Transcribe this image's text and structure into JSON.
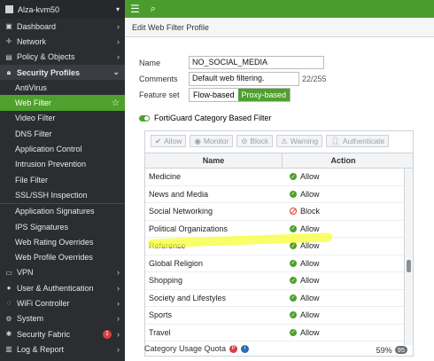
{
  "sidebar": {
    "device": "Alza-kvm50",
    "items": [
      {
        "label": "Dashboard",
        "icon": "dashboard-icon"
      },
      {
        "label": "Network",
        "icon": "network-icon"
      },
      {
        "label": "Policy & Objects",
        "icon": "policy-icon"
      },
      {
        "label": "Security Profiles",
        "icon": "lock-icon"
      }
    ],
    "sub": [
      "AntiVirus",
      "Web Filter",
      "Video Filter",
      "DNS Filter",
      "Application Control",
      "Intrusion Prevention",
      "File Filter",
      "SSL/SSH Inspection"
    ],
    "sub2": [
      "Application Signatures",
      "IPS Signatures",
      "Web Rating Overrides",
      "Web Profile Overrides"
    ],
    "items2": [
      {
        "label": "VPN",
        "icon": "vpn-icon"
      },
      {
        "label": "User & Authentication",
        "icon": "user-icon"
      },
      {
        "label": "WiFi Controller",
        "icon": "wifi-icon"
      },
      {
        "label": "System",
        "icon": "gear-icon"
      },
      {
        "label": "Security Fabric",
        "icon": "fabric-icon",
        "badge": "1"
      },
      {
        "label": "Log & Report",
        "icon": "report-icon"
      }
    ]
  },
  "header": {
    "title": "Edit Web Filter Profile"
  },
  "form": {
    "name_label": "Name",
    "name_value": "NO_SOCIAL_MEDIA",
    "comments_label": "Comments",
    "comments_value": "Default web filtering.",
    "comments_count": "22/255",
    "feature_label": "Feature set",
    "flow": "Flow-based",
    "proxy": "Proxy-based"
  },
  "filter": {
    "title": "FortiGuard Category Based Filter",
    "buttons": [
      "Allow",
      "Monitor",
      "Block",
      "Warning",
      "Authenticate"
    ],
    "col_name": "Name",
    "col_action": "Action",
    "rows": [
      {
        "name": "Medicine",
        "action": "Allow"
      },
      {
        "name": "News and Media",
        "action": "Allow"
      },
      {
        "name": "Social Networking",
        "action": "Block"
      },
      {
        "name": "Political Organizations",
        "action": "Allow"
      },
      {
        "name": "Reference",
        "action": "Allow"
      },
      {
        "name": "Global Religion",
        "action": "Allow"
      },
      {
        "name": "Shopping",
        "action": "Allow"
      },
      {
        "name": "Society and Lifestyles",
        "action": "Allow"
      },
      {
        "name": "Sports",
        "action": "Allow"
      },
      {
        "name": "Travel",
        "action": "Allow"
      }
    ],
    "footer_pct": "59%",
    "footer_count": "95"
  },
  "quota": {
    "label": "Category Usage Quota"
  },
  "colors": {
    "accent": "#4fa02d",
    "sidebar": "#2b2d31",
    "block": "#d93f3f"
  }
}
